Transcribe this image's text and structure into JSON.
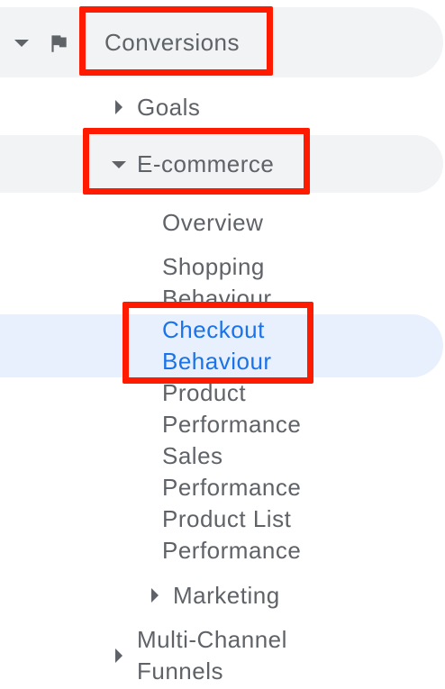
{
  "nav": {
    "conversions": {
      "label": "Conversions",
      "icon": "flag-icon",
      "expanded": true
    },
    "goals": {
      "label": "Goals",
      "expanded": false
    },
    "ecommerce": {
      "label": "E-commerce",
      "expanded": true
    },
    "ecommerce_items": {
      "overview": "Overview",
      "shopping_behaviour": "Shopping Behaviour",
      "checkout_behaviour": "Checkout Behaviour",
      "product_performance": "Product Performance",
      "sales_performance": "Sales Performance",
      "product_list_performance": "Product List Performance"
    },
    "marketing": {
      "label": "Marketing",
      "expanded": false
    },
    "multi_channel_funnels": {
      "label": "Multi-Channel Funnels",
      "expanded": false
    }
  },
  "colors": {
    "text": "#5f6368",
    "active_text": "#1a73e8",
    "row_bg": "#f1f3f4",
    "selected_bg": "#e8f0fe",
    "highlight": "#ff1a00"
  }
}
